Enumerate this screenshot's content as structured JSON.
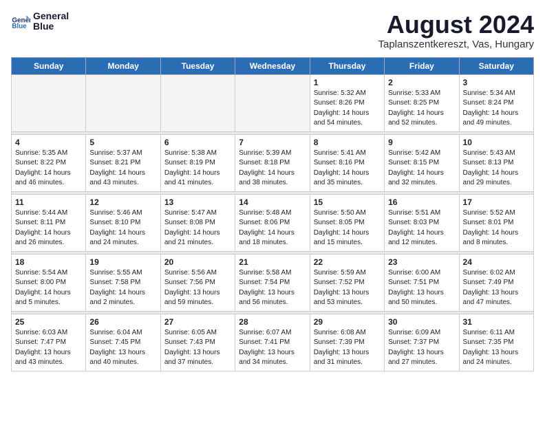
{
  "header": {
    "logo_line1": "General",
    "logo_line2": "Blue",
    "month_title": "August 2024",
    "location": "Taplanszentkereszt, Vas, Hungary"
  },
  "days_of_week": [
    "Sunday",
    "Monday",
    "Tuesday",
    "Wednesday",
    "Thursday",
    "Friday",
    "Saturday"
  ],
  "weeks": [
    [
      {
        "day": "",
        "info": ""
      },
      {
        "day": "",
        "info": ""
      },
      {
        "day": "",
        "info": ""
      },
      {
        "day": "",
        "info": ""
      },
      {
        "day": "1",
        "info": "Sunrise: 5:32 AM\nSunset: 8:26 PM\nDaylight: 14 hours\nand 54 minutes."
      },
      {
        "day": "2",
        "info": "Sunrise: 5:33 AM\nSunset: 8:25 PM\nDaylight: 14 hours\nand 52 minutes."
      },
      {
        "day": "3",
        "info": "Sunrise: 5:34 AM\nSunset: 8:24 PM\nDaylight: 14 hours\nand 49 minutes."
      }
    ],
    [
      {
        "day": "4",
        "info": "Sunrise: 5:35 AM\nSunset: 8:22 PM\nDaylight: 14 hours\nand 46 minutes."
      },
      {
        "day": "5",
        "info": "Sunrise: 5:37 AM\nSunset: 8:21 PM\nDaylight: 14 hours\nand 43 minutes."
      },
      {
        "day": "6",
        "info": "Sunrise: 5:38 AM\nSunset: 8:19 PM\nDaylight: 14 hours\nand 41 minutes."
      },
      {
        "day": "7",
        "info": "Sunrise: 5:39 AM\nSunset: 8:18 PM\nDaylight: 14 hours\nand 38 minutes."
      },
      {
        "day": "8",
        "info": "Sunrise: 5:41 AM\nSunset: 8:16 PM\nDaylight: 14 hours\nand 35 minutes."
      },
      {
        "day": "9",
        "info": "Sunrise: 5:42 AM\nSunset: 8:15 PM\nDaylight: 14 hours\nand 32 minutes."
      },
      {
        "day": "10",
        "info": "Sunrise: 5:43 AM\nSunset: 8:13 PM\nDaylight: 14 hours\nand 29 minutes."
      }
    ],
    [
      {
        "day": "11",
        "info": "Sunrise: 5:44 AM\nSunset: 8:11 PM\nDaylight: 14 hours\nand 26 minutes."
      },
      {
        "day": "12",
        "info": "Sunrise: 5:46 AM\nSunset: 8:10 PM\nDaylight: 14 hours\nand 24 minutes."
      },
      {
        "day": "13",
        "info": "Sunrise: 5:47 AM\nSunset: 8:08 PM\nDaylight: 14 hours\nand 21 minutes."
      },
      {
        "day": "14",
        "info": "Sunrise: 5:48 AM\nSunset: 8:06 PM\nDaylight: 14 hours\nand 18 minutes."
      },
      {
        "day": "15",
        "info": "Sunrise: 5:50 AM\nSunset: 8:05 PM\nDaylight: 14 hours\nand 15 minutes."
      },
      {
        "day": "16",
        "info": "Sunrise: 5:51 AM\nSunset: 8:03 PM\nDaylight: 14 hours\nand 12 minutes."
      },
      {
        "day": "17",
        "info": "Sunrise: 5:52 AM\nSunset: 8:01 PM\nDaylight: 14 hours\nand 8 minutes."
      }
    ],
    [
      {
        "day": "18",
        "info": "Sunrise: 5:54 AM\nSunset: 8:00 PM\nDaylight: 14 hours\nand 5 minutes."
      },
      {
        "day": "19",
        "info": "Sunrise: 5:55 AM\nSunset: 7:58 PM\nDaylight: 14 hours\nand 2 minutes."
      },
      {
        "day": "20",
        "info": "Sunrise: 5:56 AM\nSunset: 7:56 PM\nDaylight: 13 hours\nand 59 minutes."
      },
      {
        "day": "21",
        "info": "Sunrise: 5:58 AM\nSunset: 7:54 PM\nDaylight: 13 hours\nand 56 minutes."
      },
      {
        "day": "22",
        "info": "Sunrise: 5:59 AM\nSunset: 7:52 PM\nDaylight: 13 hours\nand 53 minutes."
      },
      {
        "day": "23",
        "info": "Sunrise: 6:00 AM\nSunset: 7:51 PM\nDaylight: 13 hours\nand 50 minutes."
      },
      {
        "day": "24",
        "info": "Sunrise: 6:02 AM\nSunset: 7:49 PM\nDaylight: 13 hours\nand 47 minutes."
      }
    ],
    [
      {
        "day": "25",
        "info": "Sunrise: 6:03 AM\nSunset: 7:47 PM\nDaylight: 13 hours\nand 43 minutes."
      },
      {
        "day": "26",
        "info": "Sunrise: 6:04 AM\nSunset: 7:45 PM\nDaylight: 13 hours\nand 40 minutes."
      },
      {
        "day": "27",
        "info": "Sunrise: 6:05 AM\nSunset: 7:43 PM\nDaylight: 13 hours\nand 37 minutes."
      },
      {
        "day": "28",
        "info": "Sunrise: 6:07 AM\nSunset: 7:41 PM\nDaylight: 13 hours\nand 34 minutes."
      },
      {
        "day": "29",
        "info": "Sunrise: 6:08 AM\nSunset: 7:39 PM\nDaylight: 13 hours\nand 31 minutes."
      },
      {
        "day": "30",
        "info": "Sunrise: 6:09 AM\nSunset: 7:37 PM\nDaylight: 13 hours\nand 27 minutes."
      },
      {
        "day": "31",
        "info": "Sunrise: 6:11 AM\nSunset: 7:35 PM\nDaylight: 13 hours\nand 24 minutes."
      }
    ]
  ]
}
